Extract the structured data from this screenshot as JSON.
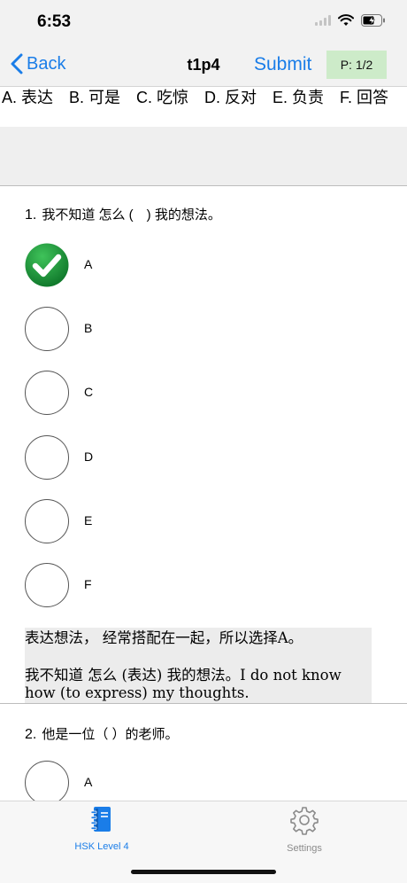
{
  "status_bar": {
    "time": "6:53"
  },
  "nav": {
    "back_label": "Back",
    "title": "t1p4",
    "submit_label": "Submit",
    "page_indicator": "P: 1/2"
  },
  "word_bank": {
    "text": "A. 表达　B. 可是　C. 吃惊　D. 反对　E. 负责　F. 回答"
  },
  "questions": [
    {
      "number": "1.",
      "prompt": "我不知道 怎么 (　) 我的想法。",
      "options": [
        "A",
        "B",
        "C",
        "D",
        "E",
        "F"
      ],
      "selected": "A",
      "explanation_line1": "表达想法， 经常搭配在一起，所以选择A。",
      "explanation_line2": "我不知道 怎么 (表达) 我的想法。I do not know how (to express) my thoughts."
    },
    {
      "number": "2.",
      "prompt": "他是一位（ ）的老师。",
      "options": [
        "A"
      ]
    }
  ],
  "tabs": [
    {
      "label": "HSK Level 4",
      "icon": "notebook-icon",
      "active": true
    },
    {
      "label": "Settings",
      "icon": "gear-icon",
      "active": false
    }
  ],
  "colors": {
    "accent": "#1a7de8",
    "correct": "#1f9a3c",
    "badge_bg": "#cdebc9",
    "inactive": "#8a8a8a"
  }
}
